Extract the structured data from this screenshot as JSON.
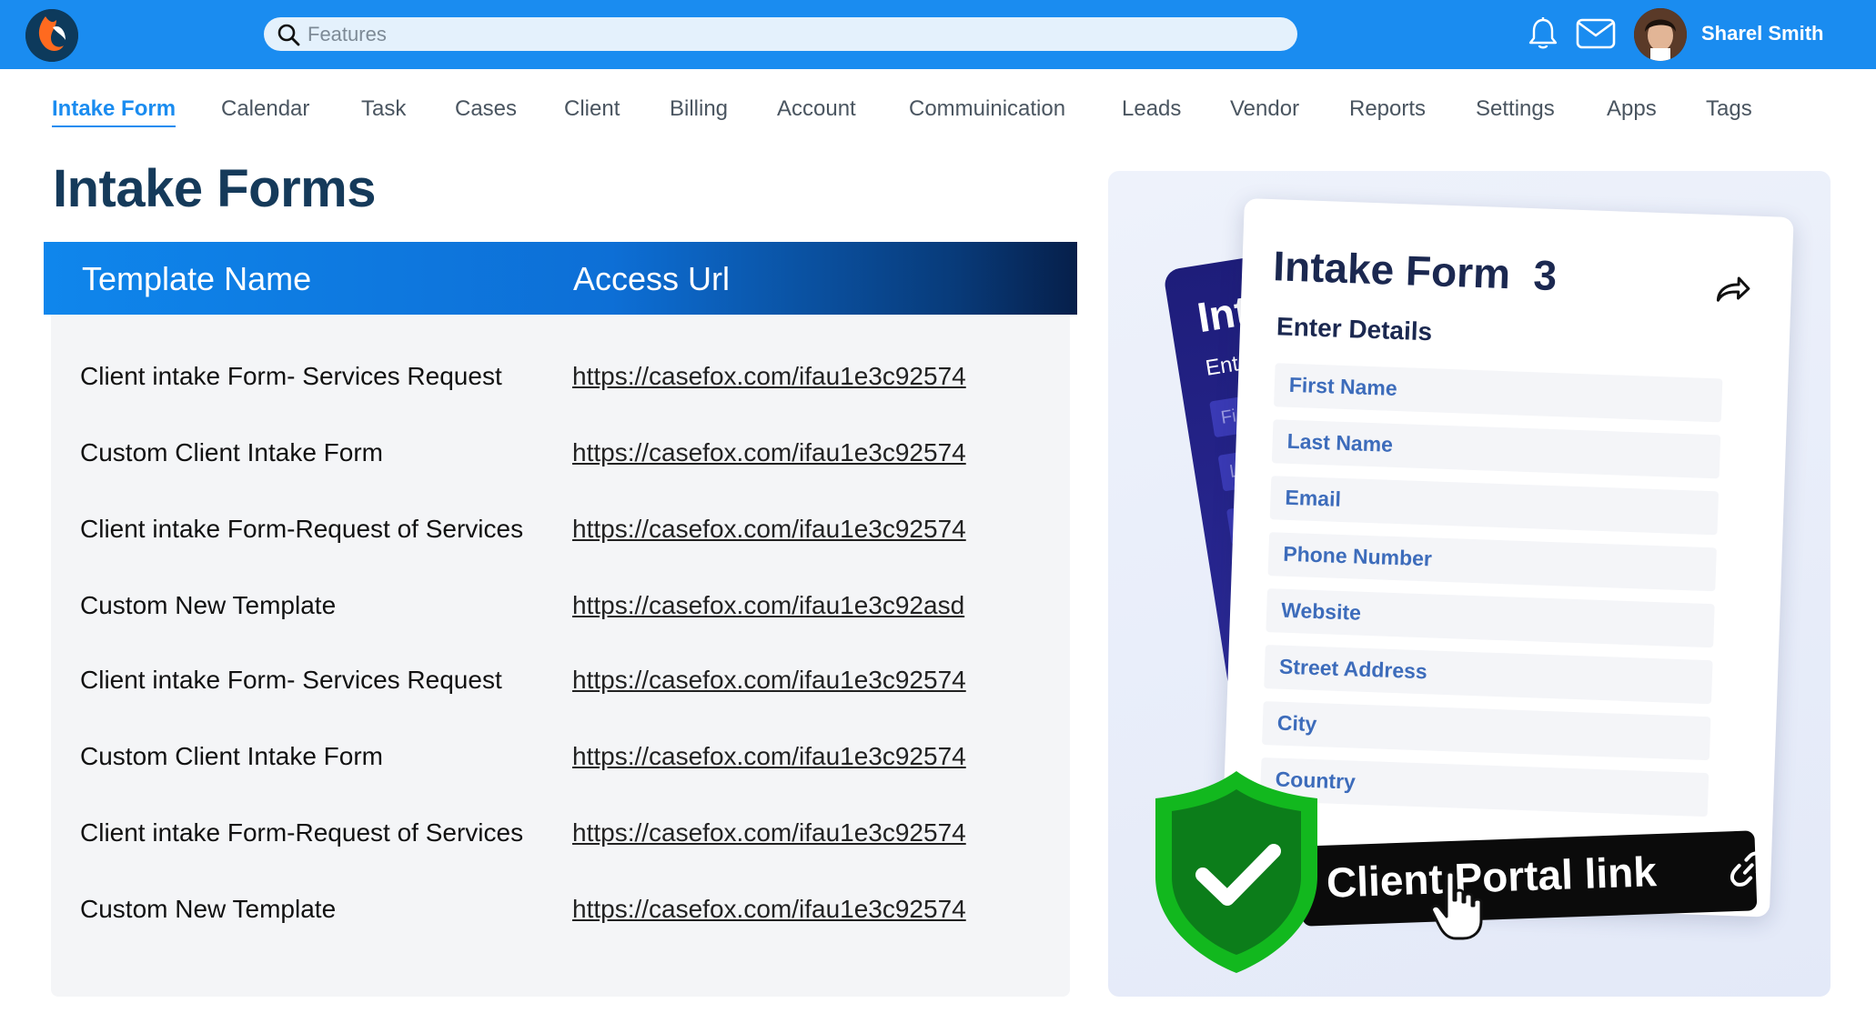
{
  "header": {
    "search_placeholder": "Features",
    "user_name": "Sharel Smith",
    "icons": [
      "logo-icon",
      "search-icon",
      "bell-icon",
      "mail-icon",
      "avatar"
    ]
  },
  "nav": {
    "items": [
      "Intake Form",
      "Calendar",
      "Task",
      "Cases",
      "Client",
      "Billing",
      "Account",
      "Commuinication",
      "Leads",
      "Vendor",
      "Reports",
      "Settings",
      "Apps",
      "Tags"
    ],
    "active": "Intake Form"
  },
  "page": {
    "title": "Intake Forms"
  },
  "table": {
    "headers": {
      "name": "Template Name",
      "url": "Access Url"
    },
    "rows": [
      {
        "name": "Client intake Form- Services Request",
        "url": "https://casefox.com/ifau1e3c92574"
      },
      {
        "name": "Custom Client Intake Form",
        "url": "https://casefox.com/ifau1e3c92574"
      },
      {
        "name": "Client intake Form-Request of Services",
        "url": "https://casefox.com/ifau1e3c92574"
      },
      {
        "name": "Custom New Template",
        "url": "https://casefox.com/ifau1e3c92asd"
      },
      {
        "name": "Client intake Form- Services Request",
        "url": "https://casefox.com/ifau1e3c92574"
      },
      {
        "name": "Custom Client Intake Form",
        "url": "https://casefox.com/ifau1e3c92574"
      },
      {
        "name": "Client intake Form-Request of Services",
        "url": "https://casefox.com/ifau1e3c92574"
      },
      {
        "name": "Custom New Template",
        "url": "https://casefox.com/ifau1e3c92574"
      }
    ]
  },
  "illustration": {
    "back_card": {
      "title": "Inta",
      "subtitle": "Ente",
      "fields": [
        "Fi",
        "L"
      ]
    },
    "front_card": {
      "title": "Intake Form  3",
      "subtitle": "Enter Details",
      "fields": [
        "First Name",
        "Last Name",
        "Email",
        "Phone Number",
        "Website",
        "Street Address",
        "City",
        "Country"
      ]
    },
    "portal_label": "Client Portal link"
  },
  "colors": {
    "brand": "#1a8cf0",
    "header_dark": "#061f4a",
    "title": "#153a5a",
    "shield": "#12b81e"
  }
}
